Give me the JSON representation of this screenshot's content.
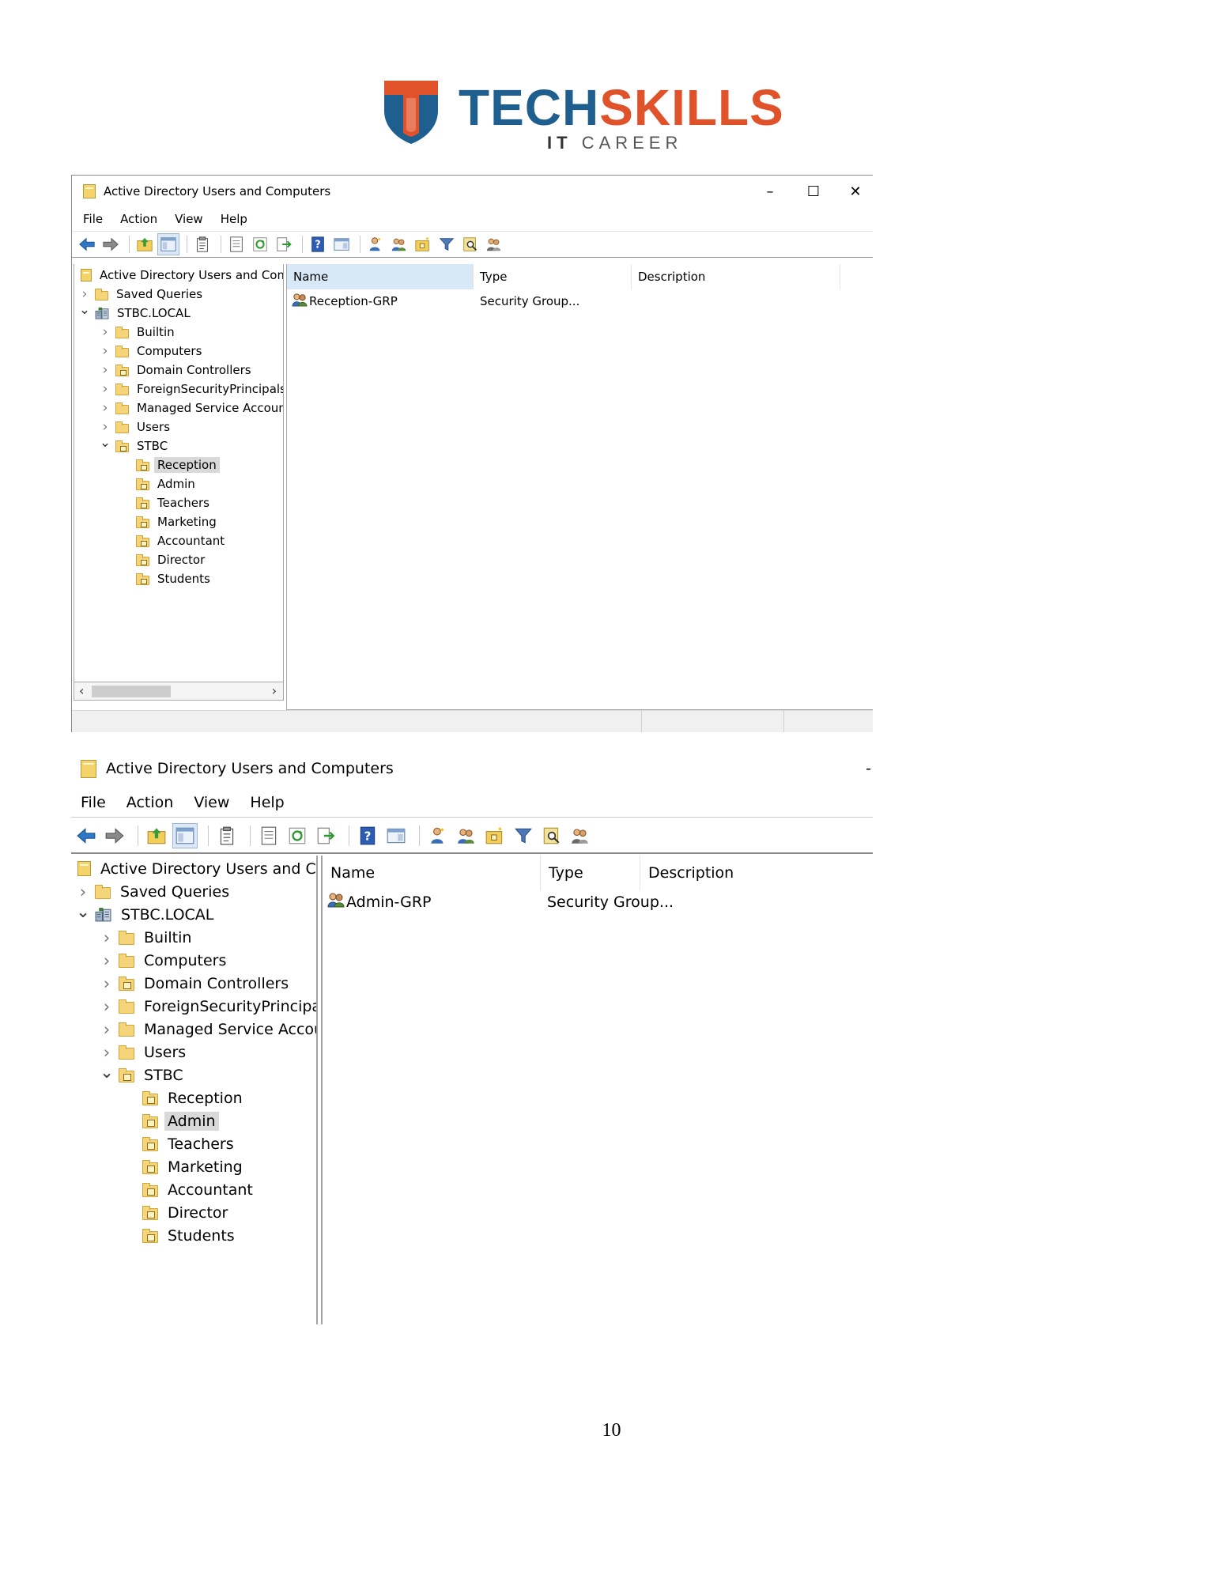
{
  "logo": {
    "brand_part1": "TECH",
    "brand_part2": "SKILLS",
    "tagline_part1": "IT",
    "tagline_part2": "CAREER"
  },
  "window1": {
    "title": "Active Directory Users and Computers",
    "controls": {
      "minimize": "–",
      "maximize": "☐",
      "close": "✕"
    },
    "menu": [
      "File",
      "Action",
      "View",
      "Help"
    ],
    "tree": [
      {
        "label": "Active Directory Users and Com",
        "level": 0,
        "expander": "",
        "icon": "snapin-icon"
      },
      {
        "label": "Saved Queries",
        "level": 1,
        "expander": "›",
        "icon": "folder-icon"
      },
      {
        "label": "STBC.LOCAL",
        "level": 1,
        "expander": "⌄",
        "icon": "domain-icon"
      },
      {
        "label": "Builtin",
        "level": 2,
        "expander": "›",
        "icon": "folder-icon"
      },
      {
        "label": "Computers",
        "level": 2,
        "expander": "›",
        "icon": "folder-icon"
      },
      {
        "label": "Domain Controllers",
        "level": 2,
        "expander": "›",
        "icon": "ou-icon"
      },
      {
        "label": "ForeignSecurityPrincipals",
        "level": 2,
        "expander": "›",
        "icon": "folder-icon"
      },
      {
        "label": "Managed Service Accounts",
        "level": 2,
        "expander": "›",
        "icon": "folder-icon"
      },
      {
        "label": "Users",
        "level": 2,
        "expander": "›",
        "icon": "folder-icon"
      },
      {
        "label": "STBC",
        "level": 2,
        "expander": "⌄",
        "icon": "ou-icon"
      },
      {
        "label": "Reception",
        "level": 3,
        "expander": "",
        "icon": "ou-icon",
        "selected": true
      },
      {
        "label": "Admin",
        "level": 3,
        "expander": "",
        "icon": "ou-icon"
      },
      {
        "label": "Teachers",
        "level": 3,
        "expander": "",
        "icon": "ou-icon"
      },
      {
        "label": "Marketing",
        "level": 3,
        "expander": "",
        "icon": "ou-icon"
      },
      {
        "label": "Accountant",
        "level": 3,
        "expander": "",
        "icon": "ou-icon"
      },
      {
        "label": "Director",
        "level": 3,
        "expander": "",
        "icon": "ou-icon"
      },
      {
        "label": "Students",
        "level": 3,
        "expander": "",
        "icon": "ou-icon"
      }
    ],
    "scroll": {
      "left": "‹",
      "right": "›"
    },
    "columns": [
      "Name",
      "Type",
      "Description"
    ],
    "rows": [
      {
        "name": "Reception-GRP",
        "type": "Security Group...",
        "description": ""
      }
    ]
  },
  "window2": {
    "title": "Active Directory Users and Computers",
    "title_trailing": "-",
    "menu": [
      "File",
      "Action",
      "View",
      "Help"
    ],
    "tree": [
      {
        "label": "Active Directory Users and Com",
        "level": 0,
        "expander": "",
        "icon": "snapin-icon"
      },
      {
        "label": "Saved Queries",
        "level": 1,
        "expander": "›",
        "icon": "folder-icon"
      },
      {
        "label": "STBC.LOCAL",
        "level": 1,
        "expander": "⌄",
        "icon": "domain-icon"
      },
      {
        "label": "Builtin",
        "level": 2,
        "expander": "›",
        "icon": "folder-icon"
      },
      {
        "label": "Computers",
        "level": 2,
        "expander": "›",
        "icon": "folder-icon"
      },
      {
        "label": "Domain Controllers",
        "level": 2,
        "expander": "›",
        "icon": "ou-icon"
      },
      {
        "label": "ForeignSecurityPrincipals",
        "level": 2,
        "expander": "›",
        "icon": "folder-icon"
      },
      {
        "label": "Managed Service Accounts",
        "level": 2,
        "expander": "›",
        "icon": "folder-icon"
      },
      {
        "label": "Users",
        "level": 2,
        "expander": "›",
        "icon": "folder-icon"
      },
      {
        "label": "STBC",
        "level": 2,
        "expander": "⌄",
        "icon": "ou-icon"
      },
      {
        "label": "Reception",
        "level": 3,
        "expander": "",
        "icon": "ou-icon"
      },
      {
        "label": "Admin",
        "level": 3,
        "expander": "",
        "icon": "ou-icon",
        "selected": true
      },
      {
        "label": "Teachers",
        "level": 3,
        "expander": "",
        "icon": "ou-icon"
      },
      {
        "label": "Marketing",
        "level": 3,
        "expander": "",
        "icon": "ou-icon"
      },
      {
        "label": "Accountant",
        "level": 3,
        "expander": "",
        "icon": "ou-icon"
      },
      {
        "label": "Director",
        "level": 3,
        "expander": "",
        "icon": "ou-icon"
      },
      {
        "label": "Students",
        "level": 3,
        "expander": "",
        "icon": "ou-icon"
      }
    ],
    "columns": [
      "Name",
      "Type",
      "Description"
    ],
    "rows": [
      {
        "name": "Admin-GRP",
        "type": "Security Group...",
        "description": ""
      }
    ]
  },
  "toolbar_icons": [
    "back-arrow-icon",
    "forward-arrow-icon",
    "sep",
    "up-folder-icon",
    "show-hide-tree-icon",
    "sep",
    "delete-clipboard-icon",
    "sep",
    "properties-icon",
    "refresh-icon",
    "export-list-icon",
    "sep",
    "help-icon",
    "show-action-pane-icon",
    "sep",
    "new-user-icon",
    "new-group-icon",
    "new-ou-icon",
    "filter-icon",
    "find-icon",
    "add-to-group-icon"
  ],
  "page_number": "10"
}
